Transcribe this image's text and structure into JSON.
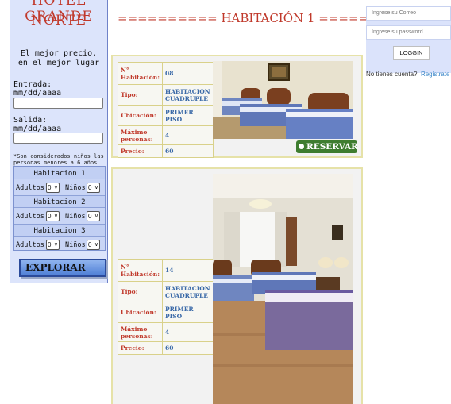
{
  "search": {
    "brand_partial": "HOTEL GRANDE",
    "brand": "NORTE",
    "tagline": "El mejor precio,\nen el mejor lugar",
    "checkin_label": "Entrada:",
    "checkin_format": "mm/dd/aaaa",
    "checkout_label": "Salida:",
    "checkout_format": "mm/dd/aaaa",
    "children_note": "*Son considerados niños las personas menores a 6 años",
    "rooms": [
      {
        "title": "Habitacion 1",
        "adults_label": "Adultos",
        "adults_value": "0",
        "kids_label": "Niños",
        "kids_value": "0"
      },
      {
        "title": "Habitacion 2",
        "adults_label": "Adultos",
        "adults_value": "0",
        "kids_label": "Niños",
        "kids_value": "0"
      },
      {
        "title": "Habitacion 3",
        "adults_label": "Adultos",
        "adults_value": "0",
        "kids_label": "Niños",
        "kids_value": "0"
      }
    ],
    "explore_label": "EXPLORAR"
  },
  "header": {
    "room_heading": "========== HABITACIÓN 1 =========="
  },
  "cards": [
    {
      "rows": [
        {
          "key": "N° Habitación:",
          "value": "08"
        },
        {
          "key": "Tipo:",
          "value": "HABITACION CUADRUPLE"
        },
        {
          "key": "Ubicación:",
          "value": "PRIMER PISO"
        },
        {
          "key": "Máximo personas:",
          "value": "4"
        },
        {
          "key": "Precio:",
          "value": "60"
        }
      ],
      "reserve_label": "RESERVAR"
    },
    {
      "rows": [
        {
          "key": "N° Habitación:",
          "value": "14"
        },
        {
          "key": "Tipo:",
          "value": "HABITACION CUADRUPLE"
        },
        {
          "key": "Ubicación:",
          "value": "PRIMER PISO"
        },
        {
          "key": "Máximo personas:",
          "value": "4"
        },
        {
          "key": "Precio:",
          "value": "60"
        }
      ]
    }
  ],
  "login": {
    "email_placeholder": "Ingrese su Correo",
    "password_placeholder": "Ingrese su password",
    "login_label": "LOGGIN",
    "no_account_text": "No tienes cuenta?: ",
    "register_link": "Registrate"
  },
  "colors": {
    "brand_red": "#c0392b",
    "panel_blue": "#dce4fb",
    "value_blue": "#3b6aa8",
    "reserve_green": "#3e7d2f",
    "card_border": "#e6e2a8"
  }
}
